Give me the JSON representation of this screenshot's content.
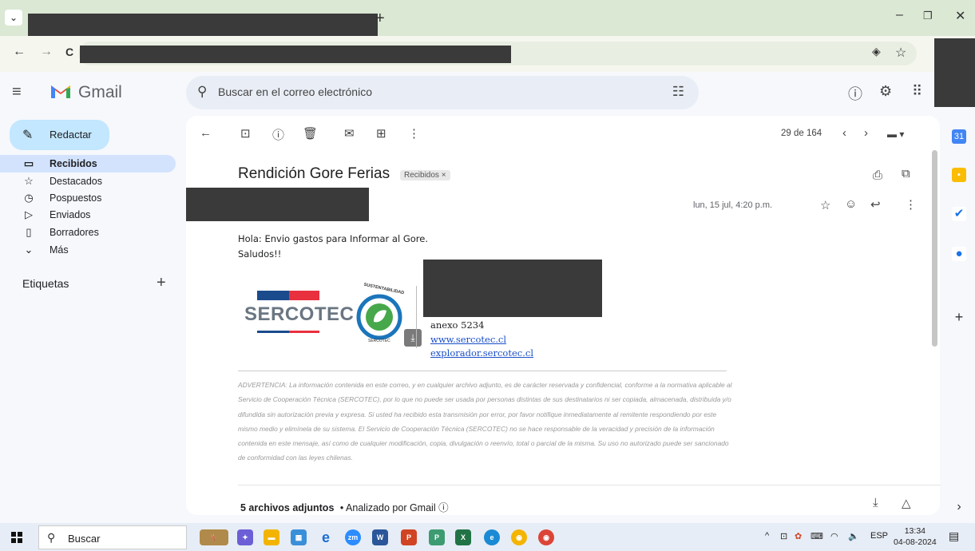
{
  "browser": {
    "new_tab": "+",
    "minimize": "–",
    "restore": "❐",
    "close": "✕",
    "back": "←",
    "forward": "→",
    "reload": "C"
  },
  "gmail": {
    "logo_text": "Gmail",
    "search_placeholder": "Buscar en el correo electrónico"
  },
  "sidebar": {
    "compose_label": "Redactar",
    "items": [
      {
        "label": "Recibidos",
        "icon": "inbox-icon",
        "glyph": "▭"
      },
      {
        "label": "Destacados",
        "icon": "star-icon",
        "glyph": "☆"
      },
      {
        "label": "Pospuestos",
        "icon": "clock-icon",
        "glyph": "◷"
      },
      {
        "label": "Enviados",
        "icon": "send-icon",
        "glyph": "▷"
      },
      {
        "label": "Borradores",
        "icon": "draft-icon",
        "glyph": "▯"
      },
      {
        "label": "Más",
        "icon": "chevron-down-icon",
        "glyph": "⌄"
      }
    ],
    "labels_heading": "Etiquetas"
  },
  "email": {
    "counter": "29 de 164",
    "subject": "Rendición Gore Ferias",
    "label_chip": "Recibidos ×",
    "date": "lun, 15 jul, 4:20 p.m.",
    "body_line1": "Hola: Envio gastos para Informar al Gore.",
    "body_line2": "Saludos!!",
    "signature": {
      "brand": "SERCOTEC",
      "badge_top": "SUSTENTABILIDAD",
      "badge_bottom": "SERCOTEC",
      "anexo": "anexo 5234",
      "link1": "www.sercotec.cl",
      "link2": "explorador.sercotec.cl"
    },
    "warning": "ADVERTENCIA: La información contenida en este correo, y en cualquier archivo adjunto, es de carácter reservada y confidencial, conforme a la normativa aplicable al Servicio de Cooperación Técnica (SERCOTEC), por lo que no puede ser usada por personas distintas de sus destinatarios ni ser copiada, almacenada, distribuida y/o difundida sin autorización previa y expresa. Si usted ha recibido esta transmisión por error, por favor notifique inmediatamente al remitente respondiendo por este mismo medio y elimínela de su sistema. El Servicio de Cooperación Técnica (SERCOTEC) no se hace responsable de la veracidad y precisión de la información contenida en este mensaje, así como de cualquier modificación, copia, divulgación o reenvío, total o parcial de la misma. Su uso no autorizado puede ser sancionado de conformidad con las leyes chilenas.",
    "attachments_bold": "5 archivos adjuntos",
    "attachments_rest": "• Analizado por Gmail ⓘ"
  },
  "taskbar": {
    "search_label": "Buscar",
    "lang": "ESP",
    "time": "13:34",
    "date": "04-08-2024"
  }
}
